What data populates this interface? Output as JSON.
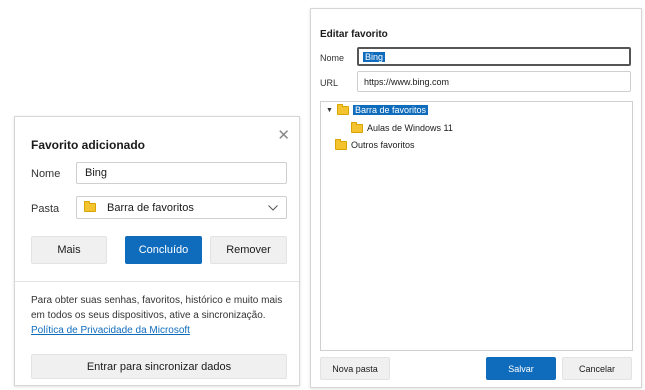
{
  "favorite_added": {
    "title": "Favorito adicionado",
    "close_glyph": "✕",
    "name_label": "Nome",
    "name_value": "Bing",
    "folder_label": "Pasta",
    "folder_value": "Barra de favoritos",
    "buttons": {
      "more": "Mais",
      "done": "Concluído",
      "remove": "Remover"
    },
    "sync_text": "Para obter suas senhas, favoritos, histórico e muito mais em todos os seus dispositivos, ative a sincronização.",
    "privacy_link": "Política de Privacidade da Microsoft",
    "sync_button": "Entrar para sincronizar dados"
  },
  "edit_favorite": {
    "title": "Editar favorito",
    "name_label": "Nome",
    "name_value": "Bing",
    "url_label": "URL",
    "url_value": "https://www.bing.com",
    "tree": [
      {
        "label": "Barra de favoritos",
        "selected": true,
        "expanded": true
      },
      {
        "label": "Aulas de Windows 11",
        "selected": false
      },
      {
        "label": "Outros favoritos",
        "selected": false
      }
    ],
    "buttons": {
      "new_folder": "Nova pasta",
      "save": "Salvar",
      "cancel": "Cancelar"
    }
  },
  "colors": {
    "accent": "#0f6cbd",
    "folder": "#f4c430"
  }
}
